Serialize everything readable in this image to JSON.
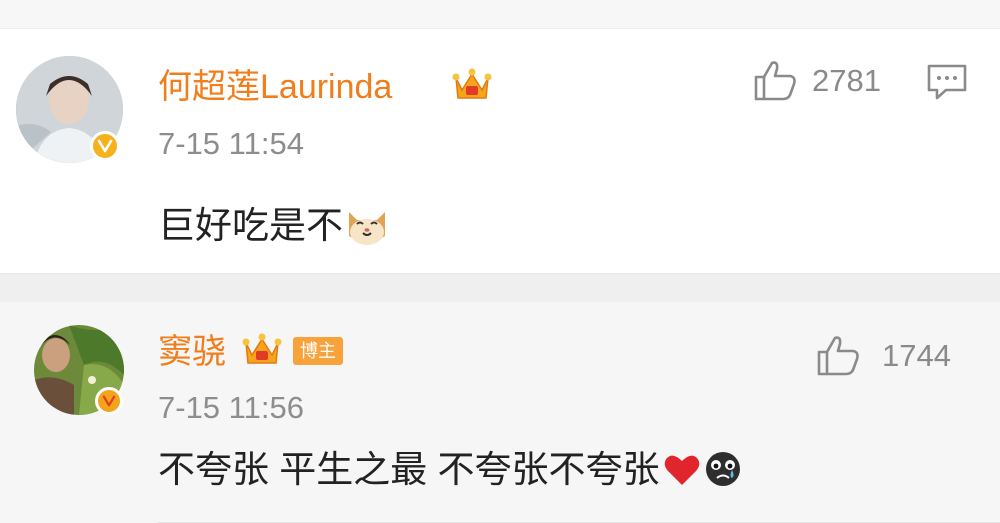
{
  "comments": [
    {
      "username": "何超莲Laurinda",
      "time": "7-15 11:54",
      "text": "巨好吃是不",
      "likes": "2781",
      "emoji": "cat-emoji"
    },
    {
      "username": "窦骁",
      "tag": "博主",
      "time": "7-15 11:56",
      "text": "不夸张 平生之最 不夸张不夸张",
      "likes": "1744",
      "emoji": [
        "heart-emoji",
        "sad-face-emoji"
      ]
    }
  ],
  "colors": {
    "username": "#f07e1c",
    "verified": "#f5b21c",
    "tag": "#f7a23b"
  }
}
